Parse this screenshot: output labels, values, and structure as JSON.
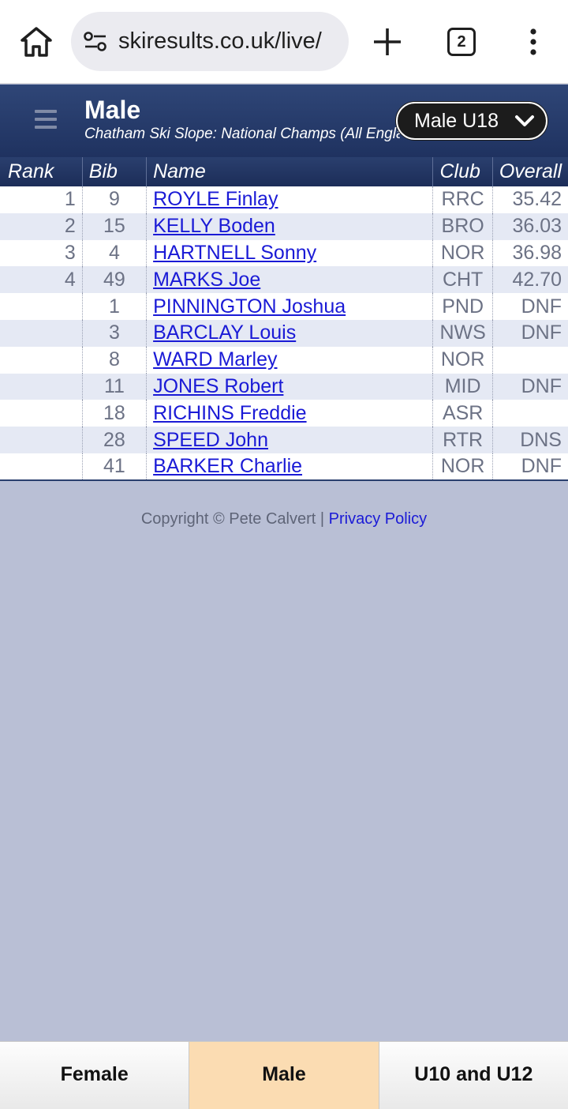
{
  "browser": {
    "url": "skiresults.co.uk/live/",
    "tab_count": "2"
  },
  "header": {
    "title": "Male",
    "subtitle": "Chatham Ski Slope: National Champs (All England)",
    "category_selected": "Male U18"
  },
  "table": {
    "columns": {
      "rank": "Rank",
      "bib": "Bib",
      "name": "Name",
      "club": "Club",
      "overall": "Overall"
    },
    "rows": [
      {
        "rank": "1",
        "bib": "9",
        "name": "ROYLE Finlay",
        "club": "RRC",
        "overall": "35.42"
      },
      {
        "rank": "2",
        "bib": "15",
        "name": "KELLY Boden",
        "club": "BRO",
        "overall": "36.03"
      },
      {
        "rank": "3",
        "bib": "4",
        "name": "HARTNELL Sonny",
        "club": "NOR",
        "overall": "36.98"
      },
      {
        "rank": "4",
        "bib": "49",
        "name": "MARKS Joe",
        "club": "CHT",
        "overall": "42.70"
      },
      {
        "rank": "",
        "bib": "1",
        "name": "PINNINGTON Joshua",
        "club": "PND",
        "overall": "DNF"
      },
      {
        "rank": "",
        "bib": "3",
        "name": "BARCLAY Louis",
        "club": "NWS",
        "overall": "DNF"
      },
      {
        "rank": "",
        "bib": "8",
        "name": "WARD Marley",
        "club": "NOR",
        "overall": ""
      },
      {
        "rank": "",
        "bib": "11",
        "name": "JONES Robert",
        "club": "MID",
        "overall": "DNF"
      },
      {
        "rank": "",
        "bib": "18",
        "name": "RICHINS Freddie",
        "club": "ASR",
        "overall": ""
      },
      {
        "rank": "",
        "bib": "28",
        "name": "SPEED John",
        "club": "RTR",
        "overall": "DNS"
      },
      {
        "rank": "",
        "bib": "41",
        "name": "BARKER Charlie",
        "club": "NOR",
        "overall": "DNF"
      }
    ]
  },
  "footer": {
    "copyright": "Copyright © Pete Calvert | ",
    "privacy_label": "Privacy Policy"
  },
  "bottom_tabs": [
    {
      "label": "Female",
      "active": false
    },
    {
      "label": "Male",
      "active": true
    },
    {
      "label": "U10 and U12",
      "active": false
    }
  ],
  "icons": {
    "home": "home-icon",
    "site_settings": "site-settings-icon",
    "new_tab": "plus-icon",
    "tabs": "tab-switcher-icon",
    "menu": "more-vert-icon",
    "hamburger": "hamburger-icon",
    "select_arrow": "chevron-down-icon"
  }
}
